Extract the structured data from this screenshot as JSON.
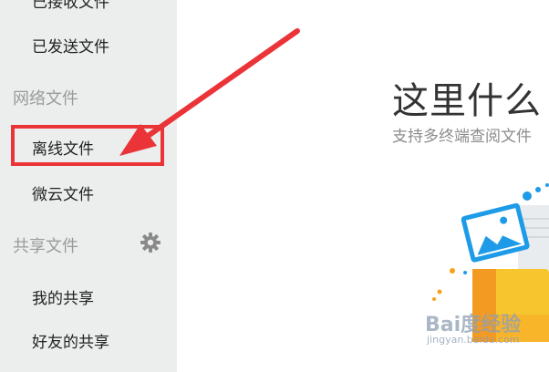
{
  "sidebar": {
    "items": [
      {
        "label": "已接收文件"
      },
      {
        "label": "已发送文件"
      },
      {
        "label": "离线文件"
      },
      {
        "label": "微云文件"
      },
      {
        "label": "我的共享"
      },
      {
        "label": "好友的共享"
      }
    ],
    "sections": [
      {
        "label": "网络文件"
      },
      {
        "label": "共享文件"
      }
    ]
  },
  "main": {
    "title": "这里什么",
    "subtitle": "支持多终端查阅文件"
  },
  "annotation": {
    "color": "#ea3438"
  },
  "watermark": {
    "brand": "Bai度经验",
    "url": "jingyan.baidu.com"
  }
}
